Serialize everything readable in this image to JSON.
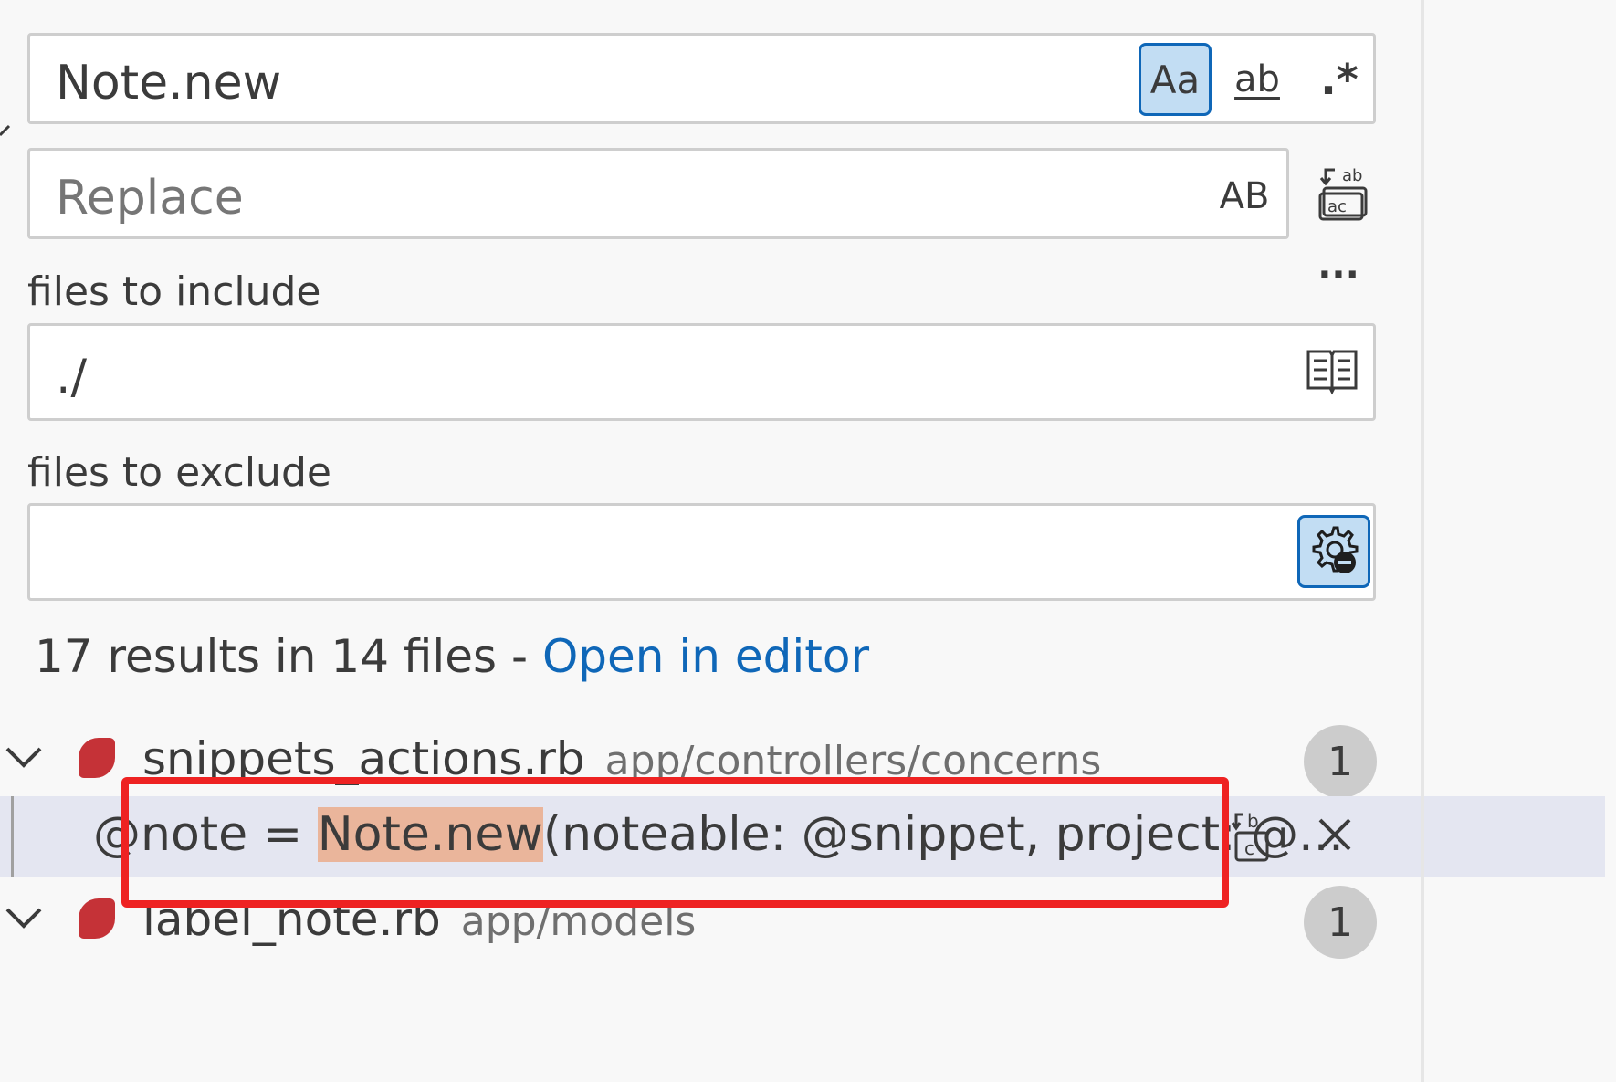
{
  "search": {
    "find_value": "Note.new",
    "match_case_label": "Aa",
    "whole_word_label": "ab",
    "regex_label": ".*",
    "replace_placeholder": "Replace",
    "preserve_case_label": "AB",
    "toggle_details_label": "...",
    "files_include_label": "files to include",
    "files_include_value": "./",
    "files_exclude_label": "files to exclude",
    "files_exclude_value": ""
  },
  "results": {
    "summary": "17 results in 14 files - ",
    "open_in_editor": "Open in editor",
    "files": [
      {
        "name": "snippets_actions.rb",
        "path": "app/controllers/concerns",
        "count": "1",
        "match": {
          "prefix": "@note = ",
          "highlight": "Note.new",
          "suffix": "(noteable: @snippet, project: @..."
        }
      },
      {
        "name": "label_note.rb",
        "path": "app/models",
        "count": "1"
      }
    ]
  },
  "colors": {
    "accent": "#0f67b8",
    "match_highlight": "#eab59b",
    "annotation_red": "#ee2222",
    "ruby_icon": "#c53237"
  }
}
